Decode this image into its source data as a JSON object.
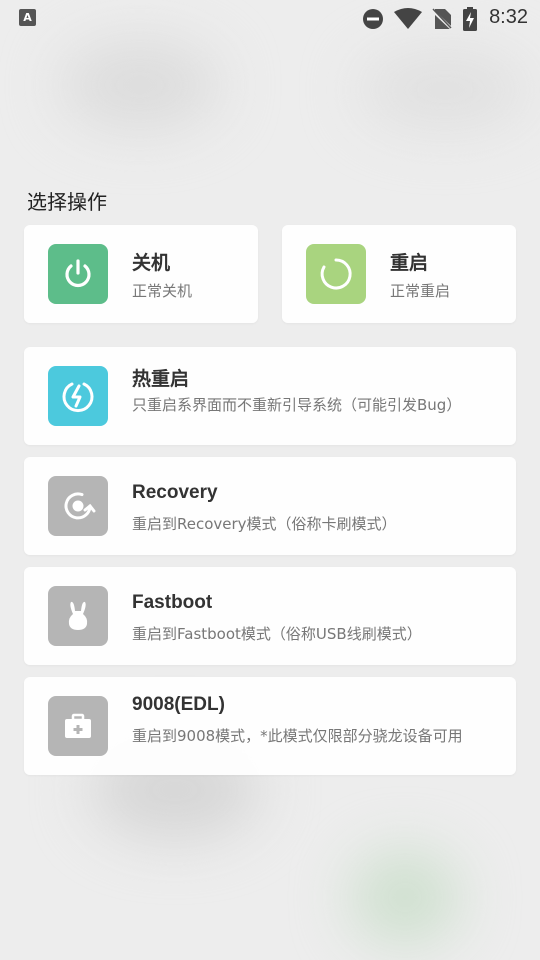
{
  "status_bar": {
    "time": "8:32",
    "left_icon": "a-icon",
    "left_icon_glyph": "A",
    "icons": [
      "dnd-icon",
      "wifi-icon",
      "no-sim-icon",
      "battery-charging-icon"
    ]
  },
  "section_title": "选择操作",
  "colors": {
    "power": "#5dbd8a",
    "restart": "#a9d47f",
    "hot_restart": "#4cc9dd",
    "gray_icon": "#b5b5b5"
  },
  "actions": {
    "power_off": {
      "title": "关机",
      "desc": "正常关机",
      "icon": "power-icon"
    },
    "restart": {
      "title": "重启",
      "desc": "正常重启",
      "icon": "restart-icon"
    },
    "hot_restart": {
      "title": "热重启",
      "desc": "只重启系界面而不重新引导系统（可能引发Bug）",
      "icon": "hot-restart-icon"
    },
    "recovery": {
      "title": "Recovery",
      "desc": "重启到Recovery模式（俗称卡刷模式）",
      "icon": "recovery-icon"
    },
    "fastboot": {
      "title": "Fastboot",
      "desc": "重启到Fastboot模式（俗称USB线刷模式）",
      "icon": "fastboot-icon"
    },
    "edl": {
      "title": "9008(EDL)",
      "desc": "重启到9008模式，*此模式仅限部分骁龙设备可用",
      "icon": "toolbox-icon"
    }
  }
}
